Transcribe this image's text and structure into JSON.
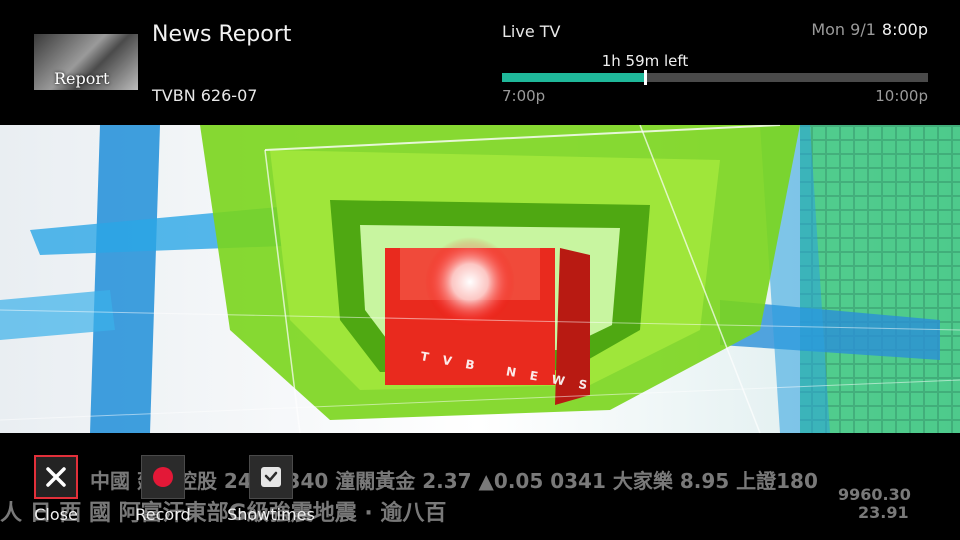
{
  "header": {
    "show_title": "News Report",
    "thumbnail_text": "Report",
    "channel": "TVBN 626-07",
    "source": "Live TV",
    "date": "Mon 9/1",
    "time": "8:00p"
  },
  "progress": {
    "time_left": "1h 59m left",
    "start": "7:00p",
    "end": "10:00p",
    "fraction": 0.335,
    "color": "#1fb89a"
  },
  "actions": [
    {
      "label": "Close",
      "icon": "close-icon",
      "focused": true
    },
    {
      "label": "Record",
      "icon": "record-icon",
      "focused": false
    },
    {
      "label": "Showtimes",
      "icon": "clock-icon",
      "focused": false
    }
  ],
  "video_overlay": {
    "logo_text": "TVB NEWS",
    "ticker_line1": "中國  建業控股  248   0340 潼關黃金 2.37 ▲0.05   0341 大家樂 8.95   上證180",
    "ticker_line2": "人  日    西  國     阿富汗東部G級強震地震 · 逾八百",
    "ticker_index": "9960.30",
    "ticker_change": "23.91"
  },
  "colors": {
    "accent": "#1fb89a",
    "focus_border": "#e2303a",
    "record": "#e31837"
  }
}
